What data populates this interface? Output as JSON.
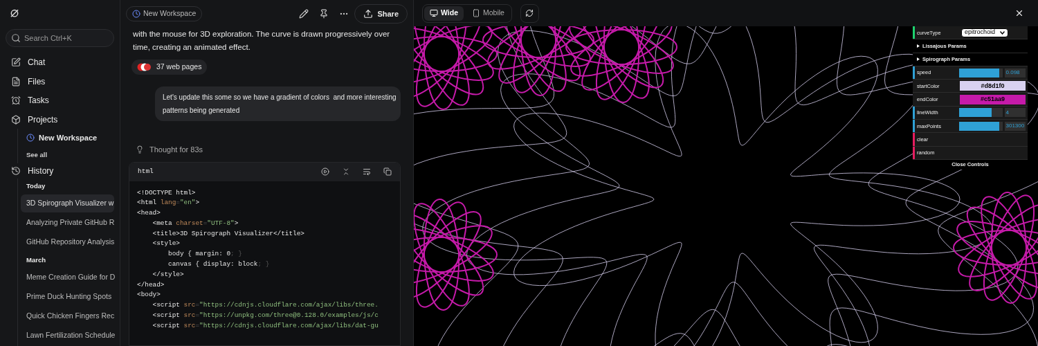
{
  "sidebar": {
    "search": {
      "placeholder": "Search Ctrl+K"
    },
    "nav": [
      {
        "label": "Chat"
      },
      {
        "label": "Files"
      },
      {
        "label": "Tasks"
      },
      {
        "label": "Projects"
      }
    ],
    "projects": {
      "items": [
        {
          "label": "New Workspace"
        }
      ],
      "see_all": "See all"
    },
    "history": {
      "label": "History",
      "groups": [
        {
          "label": "Today",
          "items": [
            {
              "label": "3D Spirograph Visualizer w",
              "selected": true
            },
            {
              "label": "Analyzing Private GitHub R",
              "selected": false
            },
            {
              "label": "GitHub Repository Analysis",
              "selected": false
            }
          ]
        },
        {
          "label": "March",
          "items": [
            {
              "label": "Meme Creation Guide for D",
              "selected": false
            },
            {
              "label": "Prime Duck Hunting Spots",
              "selected": false
            },
            {
              "label": "Quick Chicken Fingers Rec",
              "selected": false
            },
            {
              "label": "Lawn Fertilization Schedule",
              "selected": false
            }
          ]
        }
      ]
    }
  },
  "chat": {
    "workspace": "New Workspace",
    "share": "Share",
    "answer": "with the mouse for 3D exploration. The curve is drawn progressively over time, creating an animated effect.",
    "sources": "37 web pages",
    "user_message": "Let's update this some so we have a gradient of colors  and more interesting patterns being generated",
    "thought": "Thought for 83s",
    "code": {
      "language": "html",
      "lines": [
        [
          {
            "kind": "tag",
            "text": "<!DOCTYPE html>"
          }
        ],
        [
          {
            "kind": "tag",
            "text": "<html "
          },
          {
            "kind": "attr",
            "text": "lang"
          },
          {
            "kind": "punct",
            "text": "="
          },
          {
            "kind": "str",
            "text": "\"en\""
          },
          {
            "kind": "tag",
            "text": ">"
          }
        ],
        [
          {
            "kind": "tag",
            "text": "<head>"
          }
        ],
        [
          {
            "kind": "tag",
            "text": "    <meta "
          },
          {
            "kind": "attr",
            "text": "charset"
          },
          {
            "kind": "punct",
            "text": "="
          },
          {
            "kind": "str",
            "text": "\"UTF-8\""
          },
          {
            "kind": "tag",
            "text": ">"
          }
        ],
        [
          {
            "kind": "tag",
            "text": "    <title>3D Spirograph Visualizer</title>"
          }
        ],
        [
          {
            "kind": "tag",
            "text": "    <style>"
          }
        ],
        [
          {
            "kind": "tag",
            "text": "        body { margin: 0"
          },
          {
            "kind": "punct",
            "text": "; }"
          }
        ],
        [
          {
            "kind": "tag",
            "text": "        canvas { display: block"
          },
          {
            "kind": "punct",
            "text": "; }"
          }
        ],
        [
          {
            "kind": "tag",
            "text": "    </style>"
          }
        ],
        [
          {
            "kind": "tag",
            "text": "</head>"
          }
        ],
        [
          {
            "kind": "tag",
            "text": "<body>"
          }
        ],
        [
          {
            "kind": "tag",
            "text": "    <script "
          },
          {
            "kind": "attr",
            "text": "src"
          },
          {
            "kind": "punct",
            "text": "="
          },
          {
            "kind": "str",
            "text": "\"https://cdnjs.cloudflare.com/ajax/libs/three."
          }
        ],
        [
          {
            "kind": "tag",
            "text": "    <script "
          },
          {
            "kind": "attr",
            "text": "src"
          },
          {
            "kind": "punct",
            "text": "="
          },
          {
            "kind": "str",
            "text": "\"https://unpkg.com/three@0.128.0/examples/js/c"
          }
        ],
        [
          {
            "kind": "tag",
            "text": "    <script "
          },
          {
            "kind": "attr",
            "text": "src"
          },
          {
            "kind": "punct",
            "text": "="
          },
          {
            "kind": "str",
            "text": "\"https://cdnjs.cloudflare.com/ajax/libs/dat-gu"
          }
        ]
      ]
    }
  },
  "preview": {
    "views": [
      {
        "label": "Wide",
        "selected": true
      },
      {
        "label": "Mobile",
        "selected": false
      }
    ],
    "controls": {
      "rows": [
        {
          "kind": "select",
          "label": "curveType",
          "value": "epitrochoid",
          "color": "#1ed36f"
        },
        {
          "kind": "folder",
          "label": "Lissajous Params"
        },
        {
          "kind": "folder",
          "label": "Spirograph Params"
        },
        {
          "kind": "slider",
          "label": "speed",
          "value": "0.098",
          "level": 0.93,
          "color": "#2fa1d6"
        },
        {
          "kind": "color",
          "label": "startColor",
          "value": "#d8d1f0"
        },
        {
          "kind": "color",
          "label": "endColor",
          "value": "#c51aa9"
        },
        {
          "kind": "slider",
          "label": "lineWidth",
          "value": "4",
          "level": 0.75,
          "color": "#2fa1d6"
        },
        {
          "kind": "slider",
          "label": "maxPoints",
          "value": "301300",
          "level": 0.93,
          "color": "#2fa1d6"
        },
        {
          "kind": "button",
          "label": "clear",
          "color": "#e61d5f"
        },
        {
          "kind": "button",
          "label": "random",
          "color": "#e61d5f"
        }
      ],
      "close": "Close Controls"
    }
  }
}
